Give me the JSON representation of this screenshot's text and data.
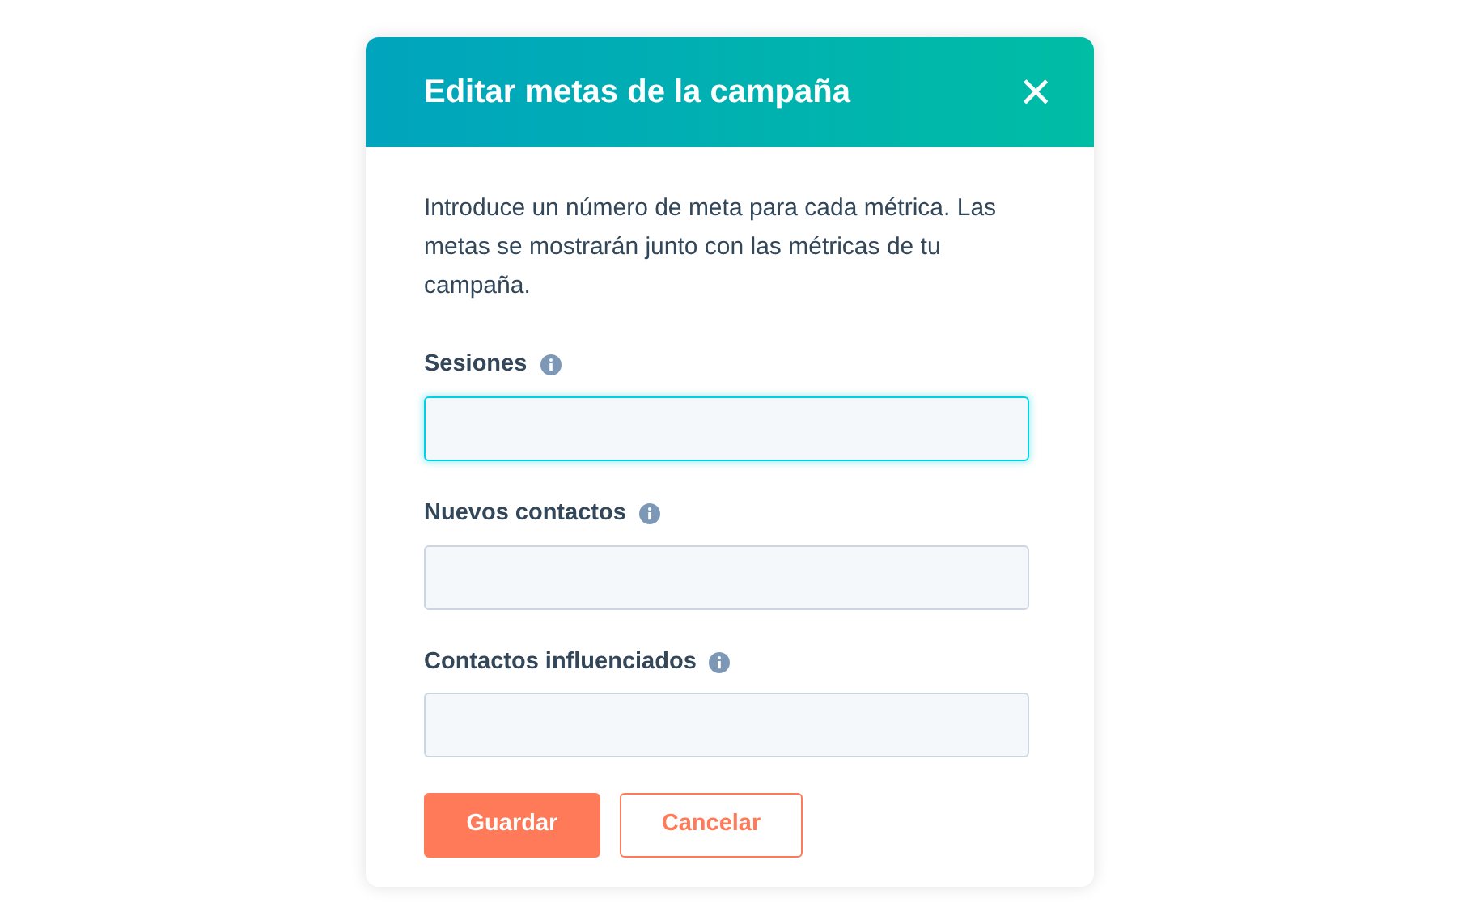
{
  "dialog": {
    "title": "Editar metas de la campaña",
    "close": "×",
    "description": "Introduce un número de meta para cada métrica. Las metas se mostrarán junto con las métricas de tu campaña.",
    "fields": [
      {
        "label": "Sesiones",
        "focused": true
      },
      {
        "label": "Nuevos contactos",
        "focused": false
      },
      {
        "label": "Contactos influenciados",
        "focused": false
      }
    ],
    "buttons": [
      {
        "label": "Guardar",
        "kind": "primary"
      },
      {
        "label": "Cancelar",
        "kind": "secondary"
      }
    ]
  }
}
